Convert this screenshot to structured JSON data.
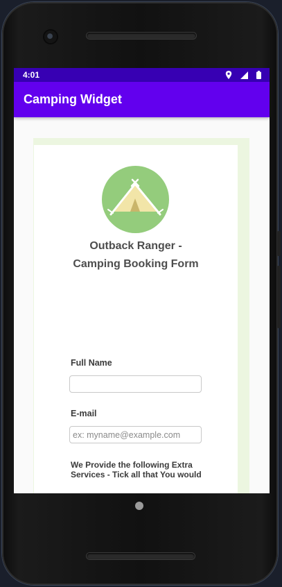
{
  "status_bar": {
    "time": "4:01",
    "icons": [
      "location-icon",
      "signal-icon",
      "battery-icon"
    ]
  },
  "app_bar": {
    "title": "Camping Widget",
    "color": "#6200ee",
    "status_color": "#3700b3"
  },
  "form": {
    "logo_icon": "tent-icon",
    "title_line1": "Outback Ranger -",
    "title_line2": "Camping Booking Form",
    "full_name_label": "Full Name",
    "full_name_value": "",
    "email_label": "E-mail",
    "email_placeholder": "ex: myname@example.com",
    "extras_label": "We Provide the following Extra Services - Tick all that You would"
  }
}
